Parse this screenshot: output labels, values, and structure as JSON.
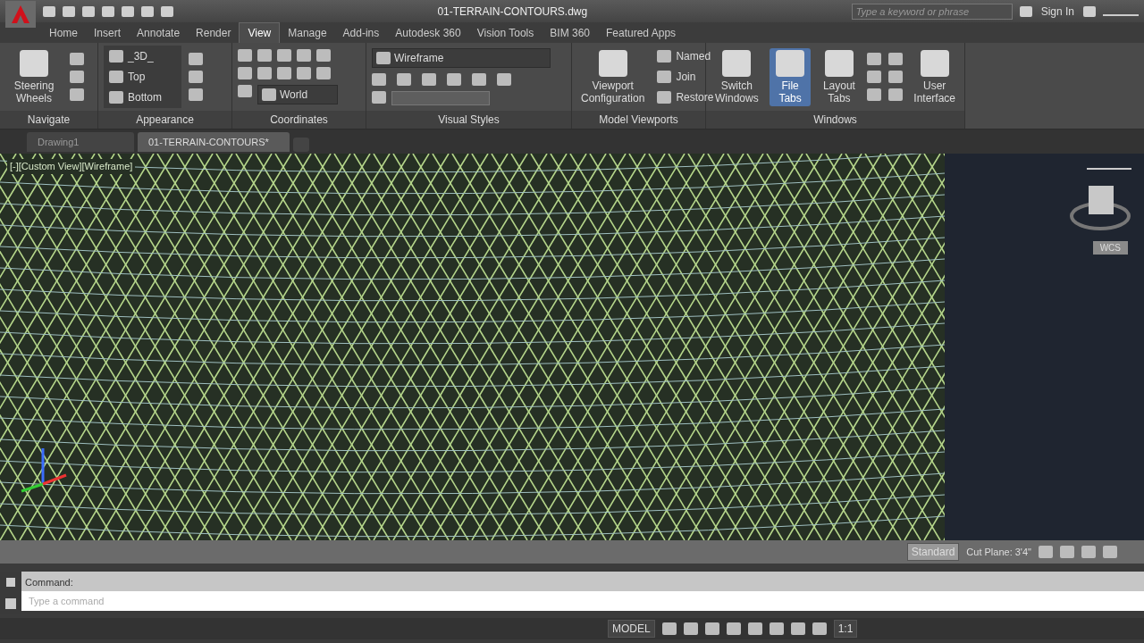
{
  "title_bar": {
    "title": "01-TERRAIN-CONTOURS.dwg",
    "search": {
      "placeholder": "Type a keyword or phrase"
    },
    "sign_in": "Sign In"
  },
  "ribbon_tabs": [
    {
      "label": "Home",
      "selected": false
    },
    {
      "label": "Insert",
      "selected": false
    },
    {
      "label": "Annotate",
      "selected": false
    },
    {
      "label": "Render",
      "selected": false
    },
    {
      "label": "View",
      "selected": true
    },
    {
      "label": "Manage",
      "selected": false
    },
    {
      "label": "Add-ins",
      "selected": false
    },
    {
      "label": "Autodesk 360",
      "selected": false
    },
    {
      "label": "Vision Tools",
      "selected": false
    },
    {
      "label": "BIM 360",
      "selected": false
    },
    {
      "label": "Featured Apps",
      "selected": false
    }
  ],
  "panels": {
    "navigate": {
      "title": "Navigate",
      "button": "Steering Wheels"
    },
    "appearance": {
      "title": "Appearance",
      "views": [
        "_3D_",
        "Top",
        "Bottom"
      ]
    },
    "coordinates": {
      "title": "Coordinates",
      "ucs": "World"
    },
    "visual_styles": {
      "title": "Visual Styles",
      "style": "Wireframe",
      "opacity_field": {
        "disabled": true
      }
    },
    "model_viewports": {
      "title": "Model Viewports",
      "large": "Viewport Configuration",
      "small": [
        "Named",
        "Join",
        "Restore"
      ]
    },
    "windows": {
      "title": "Windows",
      "buttons": [
        {
          "label": "Switch Windows",
          "on": false
        },
        {
          "label": "File Tabs",
          "on": true
        },
        {
          "label": "Layout Tabs",
          "on": false
        }
      ],
      "user_interface": "User Interface"
    }
  },
  "file_tabs": [
    {
      "label": "Drawing1",
      "selected": false
    },
    {
      "label": "01-TERRAIN-CONTOURS*",
      "selected": true
    }
  ],
  "viewport": {
    "label": "[-][Custom View][Wireframe]",
    "viewcube": "WCS"
  },
  "viewport_status": {
    "style": "Standard",
    "cut_plane": "Cut Plane: 3'4\""
  },
  "command": {
    "history": "Command:",
    "placeholder": "Type a command"
  },
  "status_bar": {
    "model": "MODEL",
    "scale": "1:1"
  }
}
